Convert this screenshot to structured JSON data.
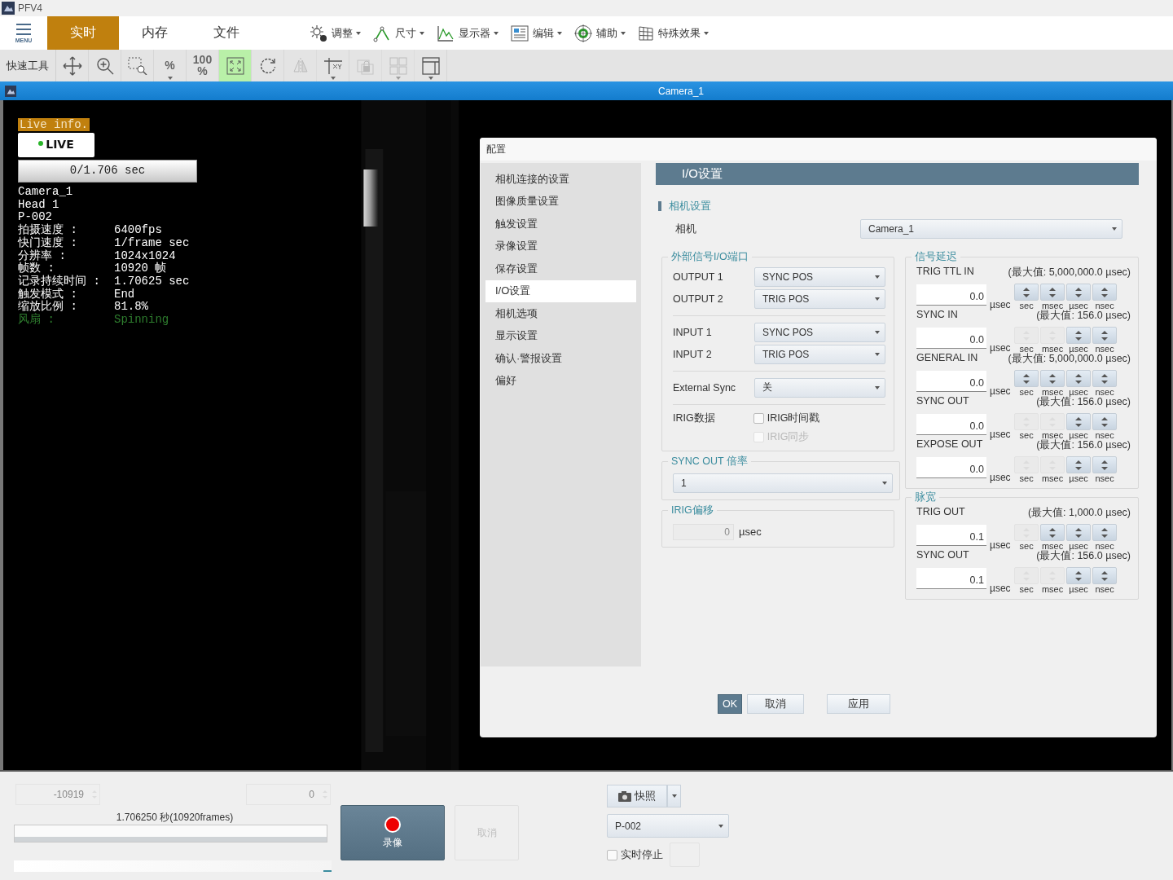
{
  "app": {
    "title": "PFV4",
    "menu_label": "MENU"
  },
  "tabs": [
    {
      "label": "实时",
      "selected": true
    },
    {
      "label": "内存",
      "selected": false
    },
    {
      "label": "文件",
      "selected": false
    }
  ],
  "menus": [
    {
      "label": "调整",
      "kind": "adjust"
    },
    {
      "label": "尺寸",
      "kind": "measure"
    },
    {
      "label": "显示器",
      "kind": "chart"
    },
    {
      "label": "编辑",
      "kind": "edit"
    },
    {
      "label": "辅助",
      "kind": "target"
    },
    {
      "label": "特殊效果",
      "kind": "grid"
    }
  ],
  "quick_tools": {
    "label": "快速工具",
    "tools": [
      {
        "kind": "move",
        "selected": false,
        "disabled": false,
        "caret": false
      },
      {
        "kind": "zoom",
        "selected": false,
        "disabled": false,
        "caret": false
      },
      {
        "kind": "zoom-rect",
        "selected": false,
        "disabled": false,
        "caret": false
      },
      {
        "kind": "text",
        "label": "%",
        "selected": false,
        "disabled": false,
        "caret": true
      },
      {
        "kind": "text",
        "label": "100\n%",
        "selected": false,
        "disabled": false,
        "caret": false
      },
      {
        "kind": "fit",
        "selected": true,
        "disabled": false,
        "caret": false
      },
      {
        "kind": "rotate",
        "selected": false,
        "disabled": false,
        "caret": false
      },
      {
        "kind": "mirror",
        "selected": false,
        "disabled": true,
        "caret": false
      },
      {
        "kind": "axes",
        "selected": false,
        "disabled": false,
        "caret": true
      },
      {
        "kind": "lock",
        "selected": false,
        "disabled": true,
        "caret": false
      },
      {
        "kind": "tiles",
        "selected": false,
        "disabled": true,
        "caret": true
      },
      {
        "kind": "layout",
        "selected": false,
        "disabled": false,
        "caret": true
      }
    ]
  },
  "camera_bar": {
    "title": "Camera_1"
  },
  "live_info": {
    "badge": "Live info.",
    "status": "LIVE",
    "progress": "0/1.706 sec",
    "header_lines": [
      "Camera_1",
      "Head 1",
      "P-002"
    ],
    "rows": [
      {
        "key": "拍摄速度 :",
        "value": "6400fps",
        "color": "#ffffff"
      },
      {
        "key": "快门速度 :",
        "value": "1/frame sec",
        "color": "#ffffff"
      },
      {
        "key": "分辨率 :",
        "value": "1024x1024",
        "color": "#ffffff"
      },
      {
        "key": "帧数 :",
        "value": "10920 帧",
        "color": "#ffffff"
      },
      {
        "key": "记录持续时间 :",
        "value": "1.70625 sec",
        "color": "#ffffff"
      },
      {
        "key": "触发模式 :",
        "value": "End",
        "color": "#ffffff"
      },
      {
        "key": "缩放比例 :",
        "value": "81.8%",
        "color": "#ffffff"
      },
      {
        "key": "风扇 :",
        "value": "Spinning",
        "color": "#2e7d2e"
      }
    ]
  },
  "dialog": {
    "title": "配置",
    "nav": [
      {
        "label": "相机连接的设置",
        "selected": false
      },
      {
        "label": "图像质量设置",
        "selected": false
      },
      {
        "label": "触发设置",
        "selected": false
      },
      {
        "label": "录像设置",
        "selected": false
      },
      {
        "label": "保存设置",
        "selected": false
      },
      {
        "label": "I/O设置",
        "selected": true
      },
      {
        "label": "相机选项",
        "selected": false
      },
      {
        "label": "显示设置",
        "selected": false
      },
      {
        "label": "确认·警报设置",
        "selected": false
      },
      {
        "label": "偏好",
        "selected": false
      }
    ],
    "header": "I/O设置",
    "camera_section": {
      "title": "相机设置",
      "label": "相机",
      "value": "Camera_1"
    },
    "io_ports": {
      "title": "外部信号I/O端口",
      "groups": [
        [
          {
            "label": "OUTPUT 1",
            "value": "SYNC POS"
          },
          {
            "label": "OUTPUT 2",
            "value": "TRIG POS"
          }
        ],
        [
          {
            "label": "INPUT 1",
            "value": "SYNC POS"
          },
          {
            "label": "INPUT 2",
            "value": "TRIG POS"
          }
        ],
        [
          {
            "label": "External Sync",
            "value": "关"
          }
        ]
      ],
      "irig_label": "IRIG数据",
      "irig_options": [
        {
          "label": "IRIG时间戳",
          "checked": false,
          "disabled": false
        },
        {
          "label": "IRIG同步",
          "checked": false,
          "disabled": true
        }
      ]
    },
    "sync_out_rate": {
      "title": "SYNC OUT 倍率",
      "value": "1"
    },
    "irig_offset": {
      "title": "IRIG偏移",
      "value": "0",
      "unit": "µsec"
    },
    "signal_delay": {
      "title": "信号延迟",
      "rows": [
        {
          "name": "TRIG TTL IN",
          "max": "(最大值: 5,000,000.0 µsec)",
          "value": "0.0",
          "unit": "µsec",
          "spinners": [
            {
              "label": "sec",
              "disabled": false
            },
            {
              "label": "msec",
              "disabled": false
            },
            {
              "label": "µsec",
              "disabled": false
            },
            {
              "label": "nsec",
              "disabled": false
            }
          ]
        },
        {
          "name": "SYNC IN",
          "max": "(最大值: 156.0 µsec)",
          "value": "0.0",
          "unit": "µsec",
          "spinners": [
            {
              "label": "sec",
              "disabled": true
            },
            {
              "label": "msec",
              "disabled": true
            },
            {
              "label": "µsec",
              "disabled": false
            },
            {
              "label": "nsec",
              "disabled": false
            }
          ]
        },
        {
          "name": "GENERAL IN",
          "max": "(最大值: 5,000,000.0 µsec)",
          "value": "0.0",
          "unit": "µsec",
          "spinners": [
            {
              "label": "sec",
              "disabled": false
            },
            {
              "label": "msec",
              "disabled": false
            },
            {
              "label": "µsec",
              "disabled": false
            },
            {
              "label": "nsec",
              "disabled": false
            }
          ]
        },
        {
          "name": "SYNC OUT",
          "max": "(最大值: 156.0 µsec)",
          "value": "0.0",
          "unit": "µsec",
          "spinners": [
            {
              "label": "sec",
              "disabled": true
            },
            {
              "label": "msec",
              "disabled": true
            },
            {
              "label": "µsec",
              "disabled": false
            },
            {
              "label": "nsec",
              "disabled": false
            }
          ]
        },
        {
          "name": "EXPOSE OUT",
          "max": "(最大值: 156.0 µsec)",
          "value": "0.0",
          "unit": "µsec",
          "spinners": [
            {
              "label": "sec",
              "disabled": true
            },
            {
              "label": "msec",
              "disabled": true
            },
            {
              "label": "µsec",
              "disabled": false
            },
            {
              "label": "nsec",
              "disabled": false
            }
          ]
        }
      ]
    },
    "pulse_width": {
      "title": "脉宽",
      "rows": [
        {
          "name": "TRIG OUT",
          "max": "(最大值: 1,000.0 µsec)",
          "value": "0.1",
          "unit": "µsec",
          "spinners": [
            {
              "label": "sec",
              "disabled": true
            },
            {
              "label": "msec",
              "disabled": false
            },
            {
              "label": "µsec",
              "disabled": false
            },
            {
              "label": "nsec",
              "disabled": false
            }
          ]
        },
        {
          "name": "SYNC OUT",
          "max": "(最大值: 156.0 µsec)",
          "value": "0.1",
          "unit": "µsec",
          "spinners": [
            {
              "label": "sec",
              "disabled": true
            },
            {
              "label": "msec",
              "disabled": true
            },
            {
              "label": "µsec",
              "disabled": false
            },
            {
              "label": "nsec",
              "disabled": false
            }
          ]
        }
      ]
    },
    "buttons": [
      {
        "label": "OK",
        "kind": "primary"
      },
      {
        "label": "取消",
        "kind": "normal"
      },
      {
        "label": "应用",
        "kind": "normal"
      }
    ]
  },
  "bottom": {
    "start_frame": "-10919",
    "end_frame": "0",
    "range": {
      "label": "1.706250 秒(10920frames)",
      "level": 1
    },
    "record": {
      "label": "录像",
      "disabled": false
    },
    "cancel": {
      "label": "取消",
      "disabled": true
    },
    "snapshot": {
      "label": "快照"
    },
    "preset": "P-002",
    "live_stop": {
      "label": "实时停止",
      "checked": false
    }
  }
}
